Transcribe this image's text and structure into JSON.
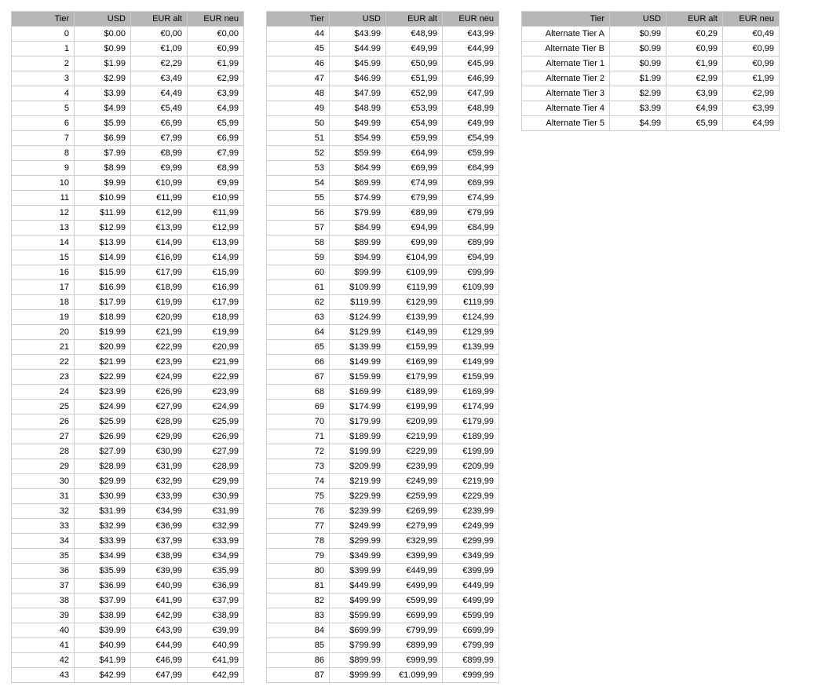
{
  "columns": [
    "Tier",
    "USD",
    "EUR alt",
    "EUR neu"
  ],
  "tables": [
    {
      "rows": [
        [
          "0",
          "$0.00",
          "€0,00",
          "€0,00"
        ],
        [
          "1",
          "$0.99",
          "€1,09",
          "€0,99"
        ],
        [
          "2",
          "$1.99",
          "€2,29",
          "€1,99"
        ],
        [
          "3",
          "$2.99",
          "€3,49",
          "€2,99"
        ],
        [
          "4",
          "$3.99",
          "€4,49",
          "€3,99"
        ],
        [
          "5",
          "$4.99",
          "€5,49",
          "€4,99"
        ],
        [
          "6",
          "$5.99",
          "€6,99",
          "€5,99"
        ],
        [
          "7",
          "$6.99",
          "€7,99",
          "€6,99"
        ],
        [
          "8",
          "$7.99",
          "€8,99",
          "€7,99"
        ],
        [
          "9",
          "$8.99",
          "€9,99",
          "€8,99"
        ],
        [
          "10",
          "$9.99",
          "€10,99",
          "€9,99"
        ],
        [
          "11",
          "$10.99",
          "€11,99",
          "€10,99"
        ],
        [
          "12",
          "$11.99",
          "€12,99",
          "€11,99"
        ],
        [
          "13",
          "$12.99",
          "€13,99",
          "€12,99"
        ],
        [
          "14",
          "$13.99",
          "€14,99",
          "€13,99"
        ],
        [
          "15",
          "$14.99",
          "€16,99",
          "€14,99"
        ],
        [
          "16",
          "$15.99",
          "€17,99",
          "€15,99"
        ],
        [
          "17",
          "$16.99",
          "€18,99",
          "€16,99"
        ],
        [
          "18",
          "$17.99",
          "€19,99",
          "€17,99"
        ],
        [
          "19",
          "$18.99",
          "€20,99",
          "€18,99"
        ],
        [
          "20",
          "$19.99",
          "€21,99",
          "€19,99"
        ],
        [
          "21",
          "$20.99",
          "€22,99",
          "€20,99"
        ],
        [
          "22",
          "$21.99",
          "€23,99",
          "€21,99"
        ],
        [
          "23",
          "$22.99",
          "€24,99",
          "€22,99"
        ],
        [
          "24",
          "$23.99",
          "€26,99",
          "€23,99"
        ],
        [
          "25",
          "$24.99",
          "€27,99",
          "€24,99"
        ],
        [
          "26",
          "$25.99",
          "€28,99",
          "€25,99"
        ],
        [
          "27",
          "$26.99",
          "€29,99",
          "€26,99"
        ],
        [
          "28",
          "$27.99",
          "€30,99",
          "€27,99"
        ],
        [
          "29",
          "$28.99",
          "€31,99",
          "€28,99"
        ],
        [
          "30",
          "$29.99",
          "€32,99",
          "€29,99"
        ],
        [
          "31",
          "$30.99",
          "€33,99",
          "€30,99"
        ],
        [
          "32",
          "$31.99",
          "€34,99",
          "€31,99"
        ],
        [
          "33",
          "$32.99",
          "€36,99",
          "€32,99"
        ],
        [
          "34",
          "$33.99",
          "€37,99",
          "€33,99"
        ],
        [
          "35",
          "$34.99",
          "€38,99",
          "€34,99"
        ],
        [
          "36",
          "$35.99",
          "€39,99",
          "€35,99"
        ],
        [
          "37",
          "$36.99",
          "€40,99",
          "€36,99"
        ],
        [
          "38",
          "$37.99",
          "€41,99",
          "€37,99"
        ],
        [
          "39",
          "$38.99",
          "€42,99",
          "€38,99"
        ],
        [
          "40",
          "$39.99",
          "€43,99",
          "€39,99"
        ],
        [
          "41",
          "$40.99",
          "€44,99",
          "€40,99"
        ],
        [
          "42",
          "$41.99",
          "€46,99",
          "€41,99"
        ],
        [
          "43",
          "$42.99",
          "€47,99",
          "€42,99"
        ]
      ]
    },
    {
      "rows": [
        [
          "44",
          "$43.99",
          "€48,99",
          "€43,99"
        ],
        [
          "45",
          "$44.99",
          "€49,99",
          "€44,99"
        ],
        [
          "46",
          "$45.99",
          "€50,99",
          "€45,99"
        ],
        [
          "47",
          "$46.99",
          "€51,99",
          "€46,99"
        ],
        [
          "48",
          "$47.99",
          "€52,99",
          "€47,99"
        ],
        [
          "49",
          "$48.99",
          "€53,99",
          "€48,99"
        ],
        [
          "50",
          "$49.99",
          "€54,99",
          "€49,99"
        ],
        [
          "51",
          "$54.99",
          "€59,99",
          "€54,99"
        ],
        [
          "52",
          "$59.99",
          "€64,99",
          "€59,99"
        ],
        [
          "53",
          "$64.99",
          "€69,99",
          "€64,99"
        ],
        [
          "54",
          "$69.99",
          "€74,99",
          "€69,99"
        ],
        [
          "55",
          "$74.99",
          "€79,99",
          "€74,99"
        ],
        [
          "56",
          "$79.99",
          "€89,99",
          "€79,99"
        ],
        [
          "57",
          "$84.99",
          "€94,99",
          "€84,99"
        ],
        [
          "58",
          "$89.99",
          "€99,99",
          "€89,99"
        ],
        [
          "59",
          "$94.99",
          "€104,99",
          "€94,99"
        ],
        [
          "60",
          "$99.99",
          "€109,99",
          "€99,99"
        ],
        [
          "61",
          "$109.99",
          "€119,99",
          "€109,99"
        ],
        [
          "62",
          "$119.99",
          "€129,99",
          "€119,99"
        ],
        [
          "63",
          "$124.99",
          "€139,99",
          "€124,99"
        ],
        [
          "64",
          "$129.99",
          "€149,99",
          "€129,99"
        ],
        [
          "65",
          "$139.99",
          "€159,99",
          "€139,99"
        ],
        [
          "66",
          "$149.99",
          "€169,99",
          "€149,99"
        ],
        [
          "67",
          "$159.99",
          "€179,99",
          "€159,99"
        ],
        [
          "68",
          "$169.99",
          "€189,99",
          "€169,99"
        ],
        [
          "69",
          "$174.99",
          "€199,99",
          "€174,99"
        ],
        [
          "70",
          "$179.99",
          "€209,99",
          "€179,99"
        ],
        [
          "71",
          "$189.99",
          "€219,99",
          "€189,99"
        ],
        [
          "72",
          "$199.99",
          "€229,99",
          "€199,99"
        ],
        [
          "73",
          "$209.99",
          "€239,99",
          "€209,99"
        ],
        [
          "74",
          "$219.99",
          "€249,99",
          "€219,99"
        ],
        [
          "75",
          "$229.99",
          "€259,99",
          "€229,99"
        ],
        [
          "76",
          "$239.99",
          "€269,99",
          "€239,99"
        ],
        [
          "77",
          "$249.99",
          "€279,99",
          "€249,99"
        ],
        [
          "78",
          "$299.99",
          "€329,99",
          "€299,99"
        ],
        [
          "79",
          "$349.99",
          "€399,99",
          "€349,99"
        ],
        [
          "80",
          "$399.99",
          "€449,99",
          "€399,99"
        ],
        [
          "81",
          "$449.99",
          "€499,99",
          "€449,99"
        ],
        [
          "82",
          "$499.99",
          "€599,99",
          "€499,99"
        ],
        [
          "83",
          "$599.99",
          "€699,99",
          "€599,99"
        ],
        [
          "84",
          "$699.99",
          "€799,99",
          "€699,99"
        ],
        [
          "85",
          "$799.99",
          "€899,99",
          "€799,99"
        ],
        [
          "86",
          "$899.99",
          "€999,99",
          "€899,99"
        ],
        [
          "87",
          "$999.99",
          "€1.099,99",
          "€999,99"
        ]
      ]
    },
    {
      "rows": [
        [
          "Alternate Tier A",
          "$0.99",
          "€0,29",
          "€0,49"
        ],
        [
          "Alternate Tier B",
          "$0.99",
          "€0,99",
          "€0,99"
        ],
        [
          "Alternate Tier 1",
          "$0.99",
          "€1,99",
          "€0,99"
        ],
        [
          "Alternate Tier 2",
          "$1.99",
          "€2,99",
          "€1,99"
        ],
        [
          "Alternate Tier 3",
          "$2.99",
          "€3,99",
          "€2,99"
        ],
        [
          "Alternate Tier 4",
          "$3.99",
          "€4,99",
          "€3,99"
        ],
        [
          "Alternate Tier 5",
          "$4.99",
          "€5,99",
          "€4,99"
        ]
      ]
    }
  ]
}
